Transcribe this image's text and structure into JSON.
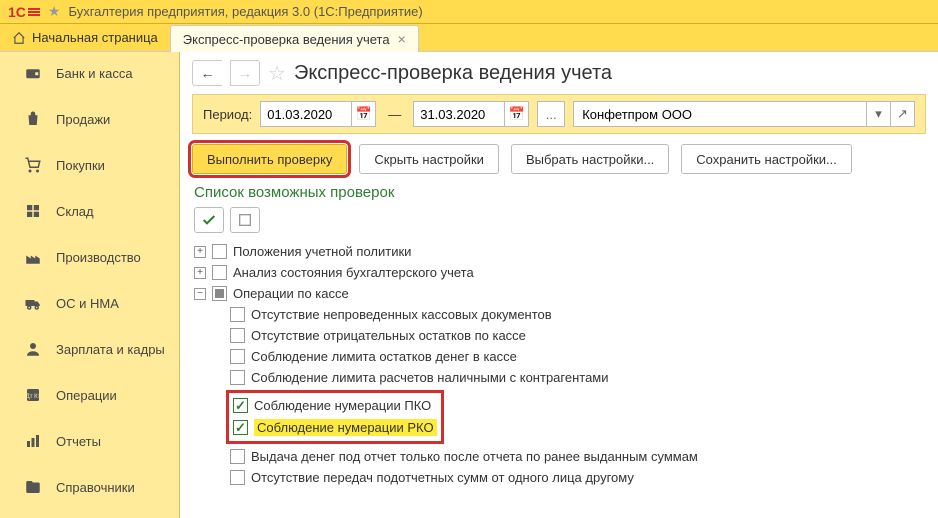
{
  "app": {
    "title": "Бухгалтерия предприятия, редакция 3.0  (1С:Предприятие)"
  },
  "tabs": {
    "home": "Начальная страница",
    "check": "Экспресс-проверка ведения учета"
  },
  "sidebar": {
    "items": [
      {
        "label": "Банк и касса"
      },
      {
        "label": "Продажи"
      },
      {
        "label": "Покупки"
      },
      {
        "label": "Склад"
      },
      {
        "label": "Производство"
      },
      {
        "label": "ОС и НМА"
      },
      {
        "label": "Зарплата и кадры"
      },
      {
        "label": "Операции"
      },
      {
        "label": "Отчеты"
      },
      {
        "label": "Справочники"
      }
    ]
  },
  "page": {
    "title": "Экспресс-проверка ведения учета"
  },
  "period": {
    "label": "Период:",
    "from": "01.03.2020",
    "to": "31.03.2020",
    "dash": "—",
    "org": "Конфетпром ООО"
  },
  "actions": {
    "run": "Выполнить проверку",
    "hide": "Скрыть настройки",
    "select": "Выбрать настройки...",
    "save": "Сохранить настройки..."
  },
  "checklist": {
    "title": "Список возможных проверок",
    "items": {
      "policy": "Положения учетной политики",
      "analysis": "Анализ состояния бухгалтерского учета",
      "cash": "Операции по кассе",
      "cash_children": {
        "c1": "Отсутствие непроведенных кассовых документов",
        "c2": "Отсутствие отрицательных остатков по кассе",
        "c3": "Соблюдение лимита остатков денег в кассе",
        "c4": "Соблюдение лимита расчетов наличными с контрагентами",
        "c5": "Соблюдение нумерации ПКО",
        "c6": "Соблюдение нумерации РКО",
        "c7": "Выдача денег под отчет только после отчета по ранее выданным суммам",
        "c8": "Отсутствие передач подотчетных сумм от одного лица другому"
      }
    }
  }
}
